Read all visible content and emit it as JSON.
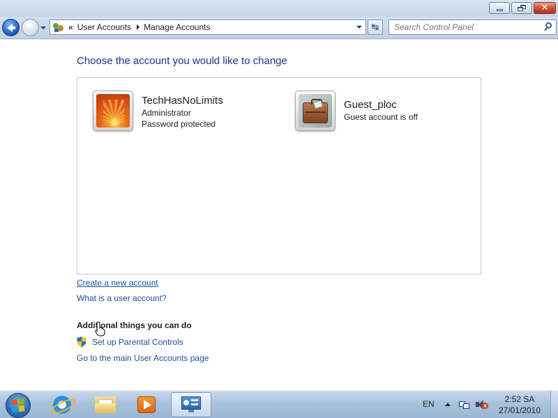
{
  "window": {
    "minimize_label": "Minimize",
    "maximize_label": "Restore Down",
    "close_label": "Close",
    "colors": {
      "title_blue": "#1e3287",
      "link_blue": "#1e4fa0",
      "close_red": "#c8492f"
    }
  },
  "navigation": {
    "back_icon": "back-arrow-icon",
    "forward_icon": "forward-arrow-icon",
    "address": {
      "separator": "«",
      "crumbs": [
        "User Accounts",
        "Manage Accounts"
      ],
      "icon": "user-accounts-icon"
    },
    "refresh_glyph": "↹",
    "search": {
      "placeholder": "Search Control Panel",
      "value": ""
    }
  },
  "main": {
    "title": "Choose the account you would like to change",
    "accounts": [
      {
        "name": "TechHasNoLimits",
        "lines": [
          "Administrator",
          "Password protected"
        ],
        "picture": "orange-flower-avatar"
      },
      {
        "name": "Guest_ploc",
        "lines": [
          "Guest account is off"
        ],
        "picture": "suitcase-avatar"
      }
    ],
    "links": {
      "create": "Create a new account",
      "what_is": "What is a user account?"
    },
    "additional": {
      "heading": "Additional things you can do",
      "parental_controls": "Set up Parental Controls",
      "main_page": "Go to the main User Accounts page"
    }
  },
  "taskbar": {
    "pinned": [
      "Internet Explorer",
      "Windows Explorer",
      "Windows Media Player",
      "Control Panel"
    ],
    "language": "EN",
    "time": "2:52 SA",
    "date": "27/01/2010"
  }
}
